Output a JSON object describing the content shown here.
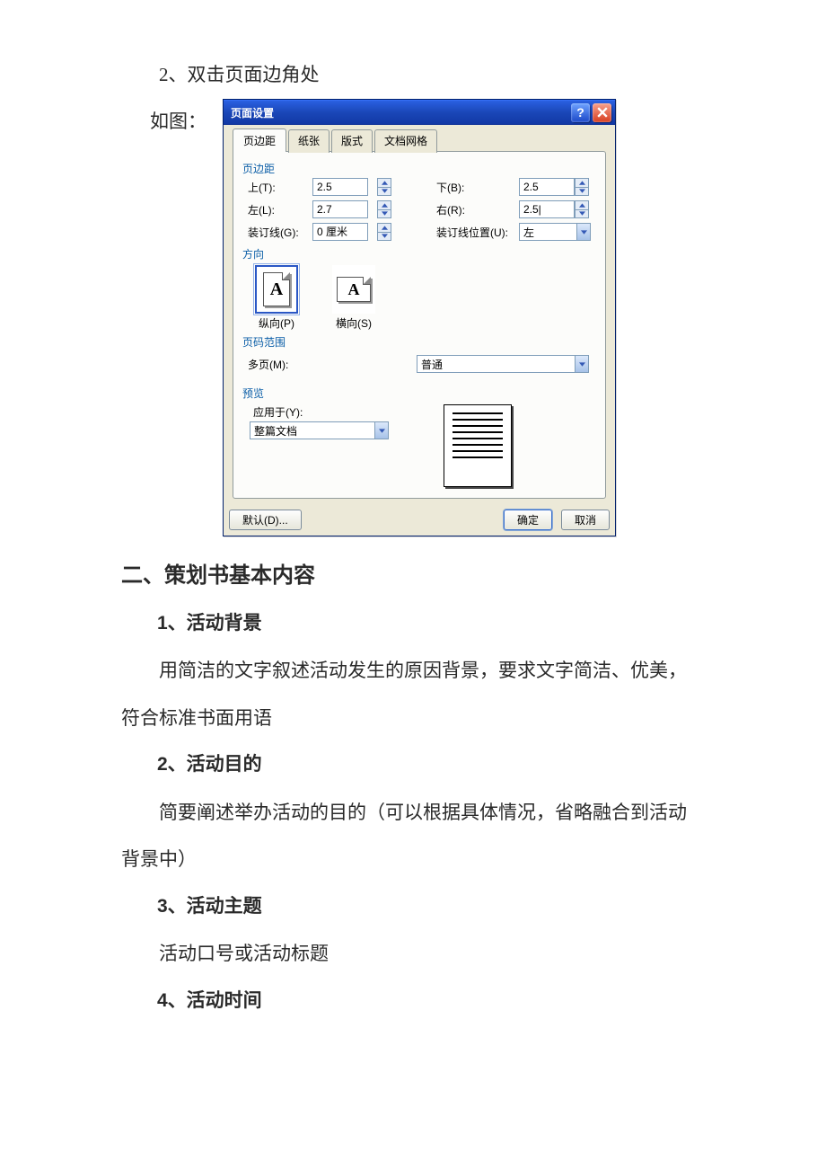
{
  "doc": {
    "pre_item": "2、双击页面边角处",
    "fig_label": "如图：",
    "h2": "二、策划书基本内容",
    "s1_title": "1、活动背景",
    "s1_body": "用简洁的文字叙述活动发生的原因背景，要求文字简洁、优美，符合标准书面用语",
    "s2_title": "2、活动目的",
    "s2_body": "简要阐述举办活动的目的（可以根据具体情况，省略融合到活动背景中）",
    "s3_title": "3、活动主题",
    "s3_body": "活动口号或活动标题",
    "s4_title": "4、活动时间"
  },
  "dlg": {
    "title": "页面设置",
    "tabs": {
      "margins": "页边距",
      "paper": "纸张",
      "layout": "版式",
      "grid": "文档网格"
    },
    "group_margins": "页边距",
    "labels": {
      "top": "上(T):",
      "bottom": "下(B):",
      "left": "左(L):",
      "right": "右(R):",
      "gutter": "装订线(G):",
      "gutter_pos": "装订线位置(U):",
      "orientation": "方向",
      "portrait": "纵向(P)",
      "landscape": "横向(S)",
      "page_range": "页码范围",
      "multipage": "多页(M):",
      "preview": "预览",
      "apply_to": "应用于(Y):"
    },
    "values": {
      "top": "2.5",
      "bottom": "2.5",
      "left": "2.7",
      "right": "2.5|",
      "gutter": "0 厘米",
      "gutter_pos": "左",
      "multipage": "普通",
      "apply_to": "整篇文档"
    },
    "buttons": {
      "default": "默认(D)...",
      "ok": "确定",
      "cancel": "取消"
    }
  }
}
